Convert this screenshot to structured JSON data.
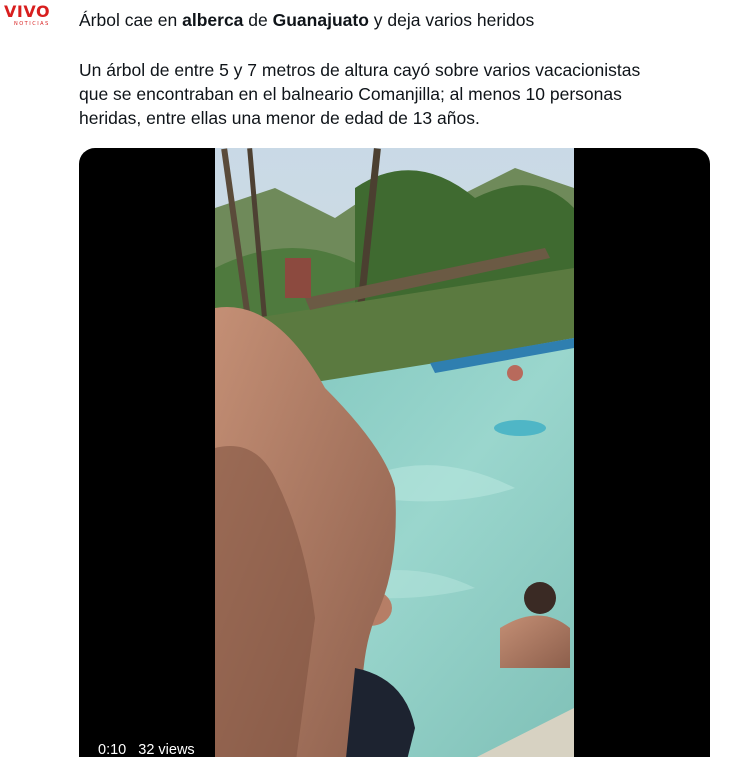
{
  "account": {
    "logo_text": "VIVO",
    "logo_subtext": "NOTICIAS"
  },
  "headline": {
    "part1": "Árbol cae en ",
    "bold1": "alberca",
    "part2": " de ",
    "bold2": "Guanajuato",
    "part3": " y deja varios heridos"
  },
  "body": {
    "line1": "Un árbol de entre 5 y 7 metros de altura cayó sobre varios vacacionistas",
    "line2": "que se encontraban en el balneario Comanjilla; al menos 10 personas",
    "line3": "heridas, entre ellas una menor de edad de 13 años."
  },
  "video": {
    "timestamp": "0:10",
    "views": "32 views"
  },
  "colors": {
    "brand": "#d81e1e",
    "text": "#0f1419",
    "pool": "#8ccfc6"
  },
  "icons": {
    "avatar": "vivo-noticias-logo"
  }
}
